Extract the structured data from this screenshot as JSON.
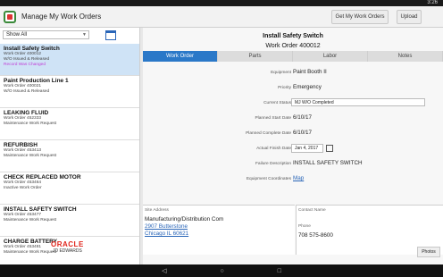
{
  "status": {
    "time": "3:26"
  },
  "app": {
    "title": "Manage My Work Orders",
    "btn_get": "Get My Work Orders",
    "btn_upload": "Upload"
  },
  "filter": {
    "value": "Show All"
  },
  "list": [
    {
      "title": "Install Safety Switch",
      "l1": "Work Order 400012",
      "l2": "W/O Issued & Released",
      "l3": "Record Was Changed"
    },
    {
      "title": "Paint Production Line 1",
      "l1": "Work Order 400021",
      "l2": "W/O Issued & Released",
      "l3": ""
    },
    {
      "title": "LEAKING FLUID",
      "l1": "Work Order 452333",
      "l2": "Maintenance Work Request",
      "l3": ""
    },
    {
      "title": "REFURBISH",
      "l1": "Work Order 453413",
      "l2": "Maintenance Work Request",
      "l3": ""
    },
    {
      "title": "CHECK REPLACED MOTOR",
      "l1": "Work Order 453464",
      "l2": "Inactive Work Order",
      "l3": ""
    },
    {
      "title": "INSTALL SAFETY SWITCH",
      "l1": "Work Order 453477",
      "l2": "Maintenance Work Request",
      "l3": ""
    },
    {
      "title": "CHARGE BATTERY",
      "l1": "Work Order 453481",
      "l2": "Maintenance Work Request",
      "l3": ""
    }
  ],
  "logo": {
    "brand": "ORACLE",
    "sub": "JD EDWARDS"
  },
  "detail": {
    "title": "Install Safety Switch",
    "wo": "Work Order 400012",
    "tabs": [
      "Work Order",
      "Parts",
      "Labor",
      "Notes"
    ],
    "fields": {
      "equipment_l": "Equipment",
      "equipment_v": "Paint Booth II",
      "priority_l": "Priority",
      "priority_v": "Emergency",
      "status_l": "Current Status",
      "status_v": "MJ W/O Completed",
      "pstart_l": "Planned Start Date",
      "pstart_v": "6/10/17",
      "pcomp_l": "Planned Complete Date",
      "pcomp_v": "6/10/17",
      "actual_l": "Actual Finish Date",
      "actual_v": "Jan 4, 2017",
      "failure_l": "Failure Description",
      "failure_v": "INSTALL SAFETY SWITCH",
      "coords_l": "Equipment Coordinates",
      "coords_v": "Map"
    },
    "site": {
      "label": "Site Address",
      "name": "Manufacturing/Distribution Com",
      "street": "2907 Butterstone",
      "city": "Chicago IL 60621"
    },
    "contact": {
      "label": "Contact Name",
      "phone_l": "Phone",
      "phone_v": "708 575-8600"
    },
    "photos": "Photos"
  }
}
